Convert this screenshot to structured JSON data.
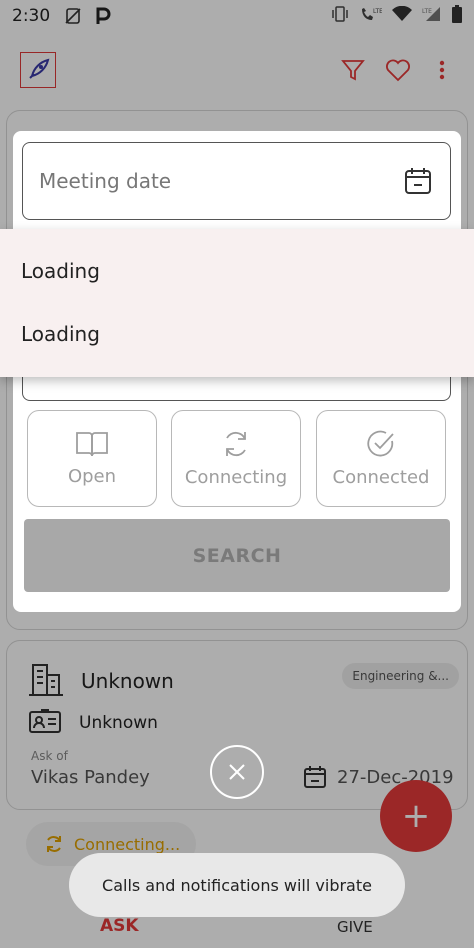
{
  "status_bar": {
    "time": "2:30",
    "icons": [
      "no-sim-icon",
      "p-icon",
      "vibrate-icon",
      "lte-call-icon",
      "wifi-icon",
      "lte-signal-icon",
      "battery-icon"
    ]
  },
  "app_bar": {
    "logo_icon": "rocket-icon",
    "actions": [
      "filter-icon",
      "heart-icon",
      "more-vert-icon"
    ]
  },
  "filter_dialog": {
    "date_placeholder": "Meeting date",
    "date_icon": "calendar-icon",
    "dropdown_items": [
      "Loading",
      "Loading"
    ],
    "status_options": [
      {
        "label": "Open",
        "icon": "book-icon"
      },
      {
        "label": "Connecting",
        "icon": "sync-icon"
      },
      {
        "label": "Connected",
        "icon": "check-circle-icon"
      }
    ],
    "search_label": "SEARCH"
  },
  "background_card": {
    "company_name": "Unknown",
    "category_chip": "Engineering &...",
    "person_name": "Unknown",
    "ask_of_label": "Ask of",
    "ask_of_name": "Vikas Pandey",
    "date": "27-Dec-2019",
    "status_label": "Connecting..."
  },
  "bottom_nav": {
    "ask_label": "ASK",
    "give_label": "GIVE"
  },
  "toast": {
    "message": "Calls and notifications will vibrate"
  },
  "colors": {
    "accent": "#e53a3a",
    "connecting": "#e1a100",
    "disabled_button": "#a8a8a8",
    "popup_bg": "#f8f0f0"
  }
}
